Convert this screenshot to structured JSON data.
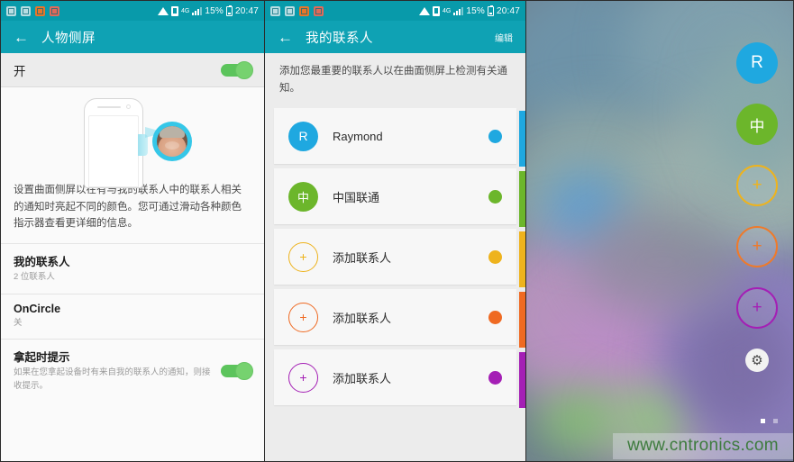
{
  "status_bar": {
    "notification_icons": [
      "message-icon",
      "email-icon",
      "news-icon",
      "sync-icon"
    ],
    "wifi_icon": "wifi-icon",
    "sim_icon": "sim-card-icon",
    "network_label": "4G",
    "signal_icon": "signal-bars-icon",
    "battery_percent": "15%",
    "battery_icon": "battery-icon",
    "time": "20:47"
  },
  "settings_panel": {
    "back_icon": "back-arrow-icon",
    "title": "人物侧屏",
    "master_switch": {
      "label": "开",
      "state": "on"
    },
    "illustration": {
      "name": "edge-screen-illustration",
      "avatar_name": "contact-avatar-photo"
    },
    "description": "设置曲面侧屏以在有与我的联系人中的联系人相关的通知时亮起不同的颜色。您可通过滑动各种颜色指示器查看更详细的信息。",
    "rows": [
      {
        "title": "我的联系人",
        "subtitle": "2 位联系人",
        "has_toggle": false
      },
      {
        "title": "OnCircle",
        "subtitle": "关",
        "has_toggle": false
      },
      {
        "title": "拿起时提示",
        "subtitle": "如果在您拿起设备时有来自我的联系人的通知，则接收提示。",
        "has_toggle": true,
        "toggle_state": "on"
      }
    ]
  },
  "contacts_panel": {
    "back_icon": "back-arrow-icon",
    "title": "我的联系人",
    "edit_label": "编辑",
    "description": "添加您最重要的联系人以在曲面侧屏上检测有关通知。",
    "contacts": [
      {
        "initial": "R",
        "name": "Raymond",
        "color": "#1fa8e0",
        "type": "contact"
      },
      {
        "initial": "中",
        "name": "中国联通",
        "color": "#6cb62b",
        "type": "contact"
      },
      {
        "initial": "+",
        "name": "添加联系人",
        "color": "#eeb31d",
        "type": "add"
      },
      {
        "initial": "+",
        "name": "添加联系人",
        "color": "#ef6a22",
        "type": "add"
      },
      {
        "initial": "+",
        "name": "添加联系人",
        "color": "#a41fb5",
        "type": "add"
      }
    ]
  },
  "edge_panel": {
    "people": [
      {
        "initial": "R",
        "color": "#1fa8e0",
        "type": "contact",
        "label": "edge-contact-raymond"
      },
      {
        "initial": "中",
        "color": "#6cb62b",
        "type": "contact",
        "label": "edge-contact-china-unicom"
      },
      {
        "initial": "+",
        "color": "#eeb31d",
        "type": "add",
        "label": "edge-add-contact-yellow"
      },
      {
        "initial": "+",
        "color": "#ef7a2a",
        "type": "add",
        "label": "edge-add-contact-orange"
      },
      {
        "initial": "+",
        "color": "#a41fb5",
        "type": "add",
        "label": "edge-add-contact-purple"
      }
    ],
    "settings_icon": "gear-icon",
    "page_dots": 2,
    "active_dot": 1,
    "watermark": "www.cntronics.com"
  },
  "colors": {
    "status_bar": "#089aaa",
    "app_bar": "#0fa2b4",
    "toggle_on": "#5cc45c",
    "panel_bg": "#ececec"
  }
}
